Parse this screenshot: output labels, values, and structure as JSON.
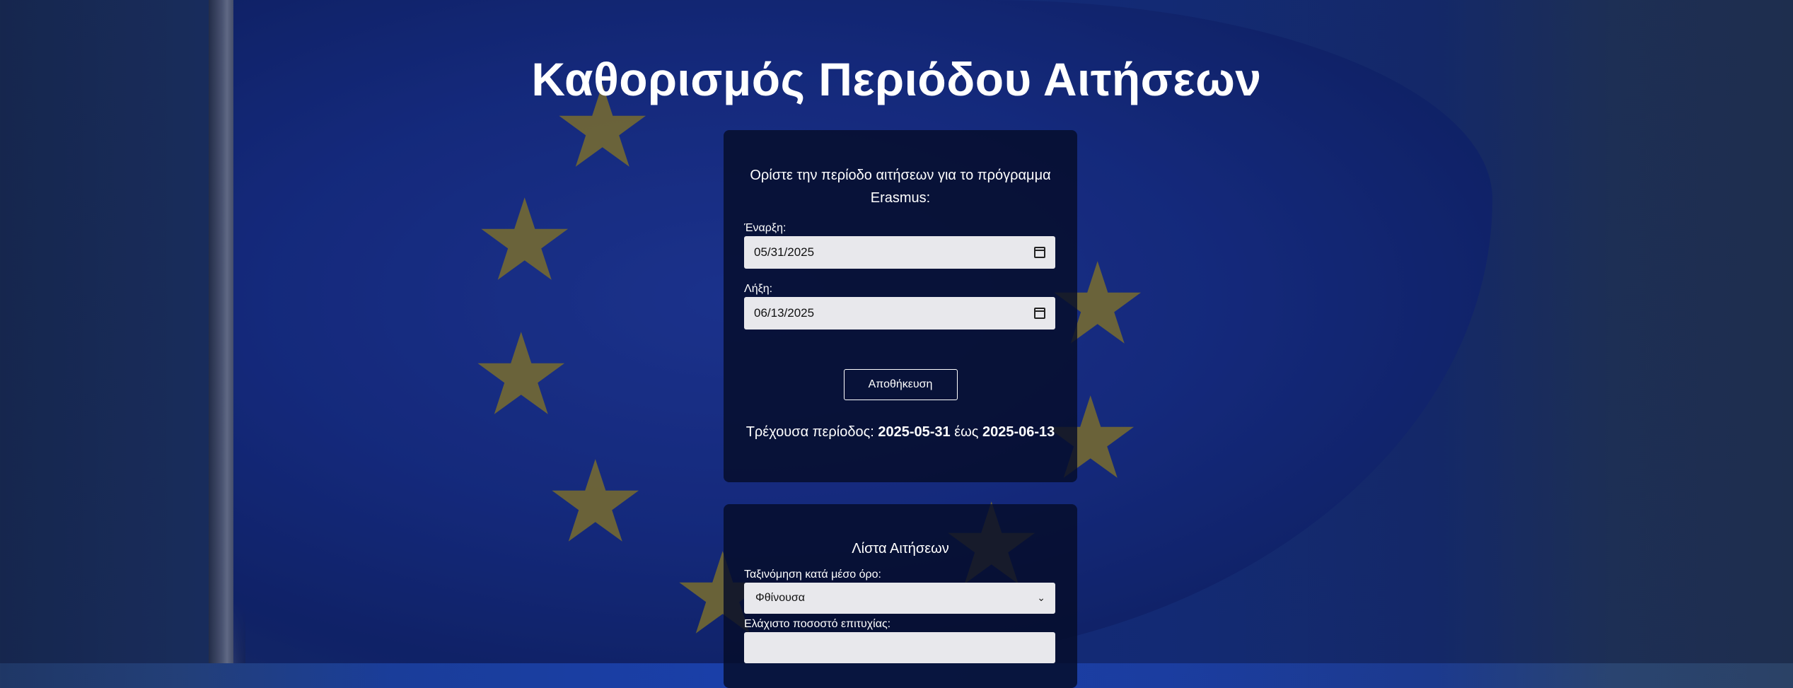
{
  "page": {
    "title": "Καθορισμός Περιόδου Αιτήσεων"
  },
  "period_panel": {
    "intro": "Ορίστε την περίοδο αιτήσεων για το πρόγραμμα Erasmus:",
    "start_label": "Έναρξη:",
    "start_value": "05/31/2025",
    "end_label": "Λήξη:",
    "end_value": "06/13/2025",
    "save_label": "Αποθήκευση",
    "current_prefix": "Τρέχουσα περίοδος:",
    "current_start": "2025-05-31",
    "current_sep": "έως",
    "current_end": "2025-06-13"
  },
  "list_panel": {
    "title": "Λίστα Αιτήσεων",
    "sort_label": "Ταξινόμηση κατά μέσο όρο:",
    "sort_value": "Φθίνουσα",
    "min_label": "Ελάχιστο ποσοστό επιτυχίας:",
    "min_value": ""
  },
  "icons": {
    "calendar": "calendar-icon",
    "dropdown": "chevron-down-icon"
  },
  "colors": {
    "panel_bg": "#050c28",
    "flag_blue": "#1d3bab",
    "star_yellow": "#b7a335"
  }
}
